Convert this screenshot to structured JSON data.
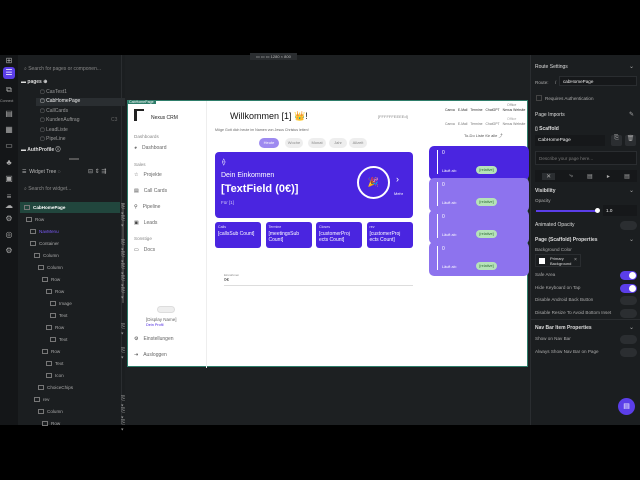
{
  "toolbar": {
    "canvas_size": "1280 × 800"
  },
  "rail": {
    "connect_label": "Connect"
  },
  "pages_panel": {
    "search_placeholder": "Search for pages or componen...",
    "folder": "pages",
    "pages": [
      "CasTest1",
      "CabHomePage",
      "CallCards",
      "KundenAuftrag",
      "LeadListe",
      "PipeLine"
    ],
    "selected": "CabHomePage",
    "shortcut": "C3",
    "folder2": "AuthProfile"
  },
  "widget_tree": {
    "title": "Widget Tree",
    "search_placeholder": "Search for widget...",
    "items": [
      {
        "label": "CabHomePage",
        "indent": 0,
        "selected": true
      },
      {
        "label": "Row",
        "indent": 1
      },
      {
        "label": "NavMenu",
        "indent": 2,
        "component": true
      },
      {
        "label": "Container",
        "indent": 2
      },
      {
        "label": "Column",
        "indent": 3
      },
      {
        "label": "Column",
        "indent": 4
      },
      {
        "label": "Row",
        "indent": 5
      },
      {
        "label": "Row",
        "indent": 6
      },
      {
        "label": "Image",
        "indent": 7
      },
      {
        "label": "Text",
        "indent": 7
      },
      {
        "label": "Row",
        "indent": 6
      },
      {
        "label": "Text",
        "indent": 7
      },
      {
        "label": "Row",
        "indent": 5
      },
      {
        "label": "Text",
        "indent": 6
      },
      {
        "label": "Icon",
        "indent": 6
      },
      {
        "label": "ChoiceChips",
        "indent": 4
      },
      {
        "label": "rev",
        "indent": 3
      },
      {
        "label": "Column",
        "indent": 4
      },
      {
        "label": "Row",
        "indent": 5
      }
    ]
  },
  "preview": {
    "page_tag": "CabHomePage",
    "brand": "Nexus CRM",
    "sidebar": {
      "sections": [
        "Dashboards",
        "Sales",
        "Sonstige"
      ],
      "items": [
        "Dashboard",
        "Projekte",
        "Call Cards",
        "Pipeline",
        "Leads",
        "Docs"
      ],
      "display_name": "[Display Name]",
      "profile_link": "Dein Profil",
      "settings": "Einstellungen",
      "logout": "Ausloggen"
    },
    "title": "Willkommen [1] 👑!",
    "subtitle": "Möge Gott dich heute im Namen von Jesus Christus leiten!",
    "top_right": "[FFFFFFEEEEd]",
    "chips": [
      "Heute",
      "Woche",
      "Monat",
      "Jahr",
      "Allzeit"
    ],
    "income": {
      "label": "Dein Einkommen",
      "value": "[TextField (0€)]",
      "sub": "Für [1]",
      "more": "Mehr"
    },
    "stats": [
      {
        "label": "Calls",
        "value": "[callsSub Count]"
      },
      {
        "label": "Termine",
        "value": "[meetingsSub Count]"
      },
      {
        "label": "Closes",
        "value": "[customerProj ects Count]"
      },
      {
        "label": "rev",
        "value": "[customerProj ects Count]"
      }
    ],
    "field": {
      "label": "Einnahmen",
      "value": "0€"
    },
    "links_label": "Office",
    "links": [
      "Canva",
      "E-Mail",
      "Termine",
      "ChatGPT",
      "Nexus Website"
    ],
    "todo_title": "To-Do Liste für alle",
    "todos": [
      {
        "count": "0",
        "label": "Läuft ab:",
        "badge": "[relative]"
      },
      {
        "count": "0",
        "label": "Läuft ab:",
        "badge": "[relative]"
      },
      {
        "count": "0",
        "label": "Läuft ab:",
        "badge": "[relative]"
      },
      {
        "count": "0",
        "label": "Läuft ab:",
        "badge": "[relative]"
      }
    ]
  },
  "properties": {
    "route_settings": "Route Settings",
    "route_label": "Route:",
    "route_slash": "/",
    "route_value": "cabHomePage",
    "requires_auth": "Requires Authentication",
    "page_imports": "Page Imports",
    "scaffold": "Scaffold",
    "page_name": "CabHomePage",
    "describe_placeholder": "Describe your page here...",
    "visibility": "Visibility",
    "opacity": "Opacity",
    "opacity_value": "1.0",
    "opacity_fraction": 1.0,
    "animated_opacity": "Animated Opacity",
    "scaffold_props": "Page (Scaffold) Properties",
    "bg_color": "Background Color",
    "bg_value": "Primary Background",
    "toggles": [
      {
        "label": "Safe Area",
        "on": true
      },
      {
        "label": "Hide Keyboard on Tap",
        "on": true
      },
      {
        "label": "Disable Android Back Button",
        "on": false
      },
      {
        "label": "Disable Resize To Avoid Bottom Inset",
        "on": false
      }
    ],
    "navbar_props": "Nav Bar Item Properties",
    "navbar_toggles": [
      {
        "label": "Show on Nav Bar",
        "on": false
      },
      {
        "label": "Always Show Nav Bar on Page",
        "on": false
      }
    ]
  },
  "colors": {
    "accent": "#5b3ee8",
    "card": "#4a25e0",
    "card_light": "#8d73ee",
    "teal": "#2e7d6a"
  }
}
